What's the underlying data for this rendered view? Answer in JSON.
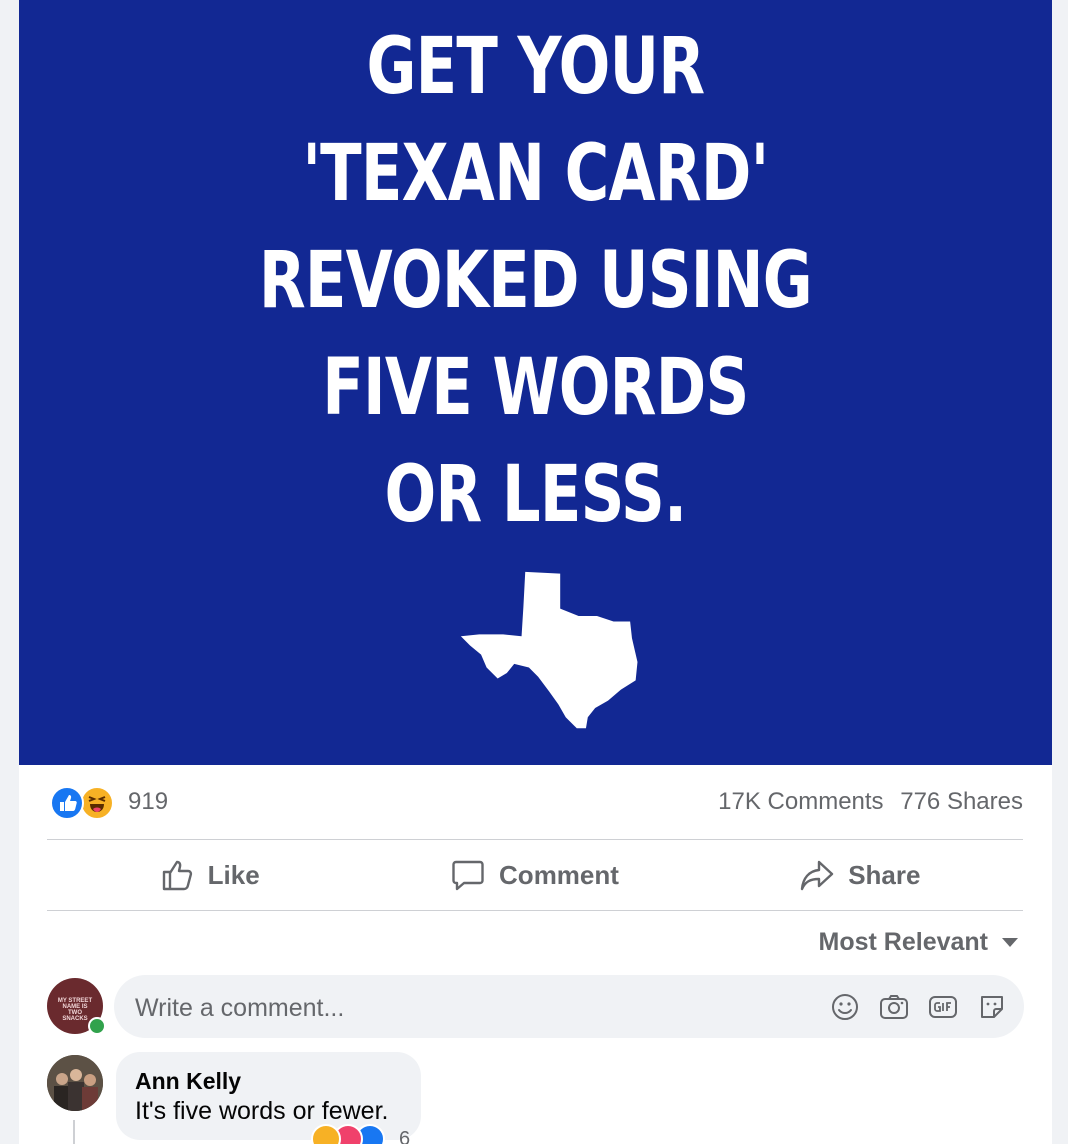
{
  "post": {
    "image": {
      "headline_lines": [
        "GET YOUR",
        "'TEXAN CARD'",
        "REVOKED USING",
        "FIVE WORDS",
        "OR LESS."
      ],
      "background_color": "#122893",
      "shape_icon": "texas-state-icon"
    },
    "stats": {
      "reactions": [
        "like-icon",
        "haha-icon"
      ],
      "reaction_count": "919",
      "comments": "17K Comments",
      "shares": "776 Shares"
    },
    "actions": {
      "like_label": "Like",
      "comment_label": "Comment",
      "share_label": "Share"
    },
    "sort_label": "Most Relevant",
    "composer": {
      "placeholder": "Write a comment...",
      "avatar_text": "MY STREET NAME IS TWO SNACKS",
      "icons": [
        "emoji-icon",
        "camera-icon",
        "gif-icon",
        "sticker-icon"
      ]
    },
    "comments": [
      {
        "author": "Ann Kelly",
        "text": "It's five words or fewer.",
        "reactions": [
          "haha-icon",
          "love-icon",
          "like-icon"
        ],
        "reaction_count": "6"
      }
    ]
  },
  "colors": {
    "brand_blue": "#1877f2",
    "muted_text": "#65676b",
    "online": "#31a24c"
  }
}
